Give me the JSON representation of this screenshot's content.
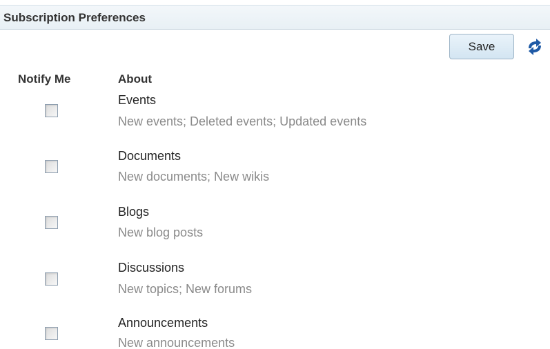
{
  "panel": {
    "title": "Subscription Preferences"
  },
  "toolbar": {
    "save_label": "Save",
    "refresh_icon": "refresh-arrows-icon"
  },
  "columns": {
    "notify": "Notify Me",
    "about": "About"
  },
  "items": [
    {
      "title": "Events",
      "description": "New events; Deleted events; Updated events",
      "checked": false
    },
    {
      "title": "Documents",
      "description": "New documents; New wikis",
      "checked": false
    },
    {
      "title": "Blogs",
      "description": "New blog posts",
      "checked": false
    },
    {
      "title": "Discussions",
      "description": "New topics; New forums",
      "checked": false
    },
    {
      "title": "Announcements",
      "description": "New announcements",
      "checked": false
    }
  ],
  "colors": {
    "header_bg": "#e8f0f5",
    "button_bg": "#d3e5f2",
    "refresh_icon": "#1f5aa6",
    "description_text": "#8a8a8a"
  }
}
